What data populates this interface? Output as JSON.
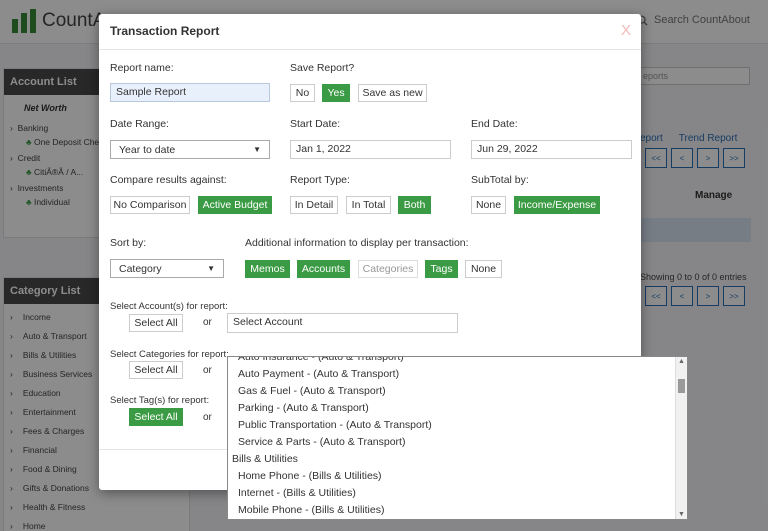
{
  "app": {
    "brand": "CountA",
    "search_label": "Search CountAbout"
  },
  "account_list": {
    "title": "Account List",
    "net_worth": "Net Worth",
    "groups": [
      {
        "label": "Banking",
        "sub": "One Deposit Che..."
      },
      {
        "label": "Credit",
        "sub": "CitiÃ®Ã / A..."
      },
      {
        "label": "Investments",
        "sub": "Individual"
      }
    ]
  },
  "category_list": {
    "title": "Category List",
    "items": [
      "Income",
      "Auto & Transport",
      "Bills & Utilities",
      "Business Services",
      "Education",
      "Entertainment",
      "Fees & Charges",
      "Financial",
      "Food & Dining",
      "Gifts & Donations",
      "Health & Fitness",
      "Home"
    ]
  },
  "background": {
    "filter_placeholder": "eports",
    "link_report": "eport",
    "link_trend": "Trend Report",
    "pager": [
      "<<",
      "<",
      ">",
      ">>"
    ],
    "manage_header": "Manage",
    "showing_text": "Showing 0 to 0 of 0 entries"
  },
  "modal": {
    "title": "Transaction Report",
    "close_glyph": "X",
    "report_name_label": "Report name:",
    "report_name_value": "Sample Report",
    "save_report_label": "Save Report?",
    "save_options": [
      "No",
      "Yes",
      "Save as new"
    ],
    "date_range_label": "Date Range:",
    "date_range_value": "Year to date",
    "start_date_label": "Start Date:",
    "start_date_value": "Jan 1, 2022",
    "end_date_label": "End Date:",
    "end_date_value": "Jun 29, 2022",
    "compare_label": "Compare results against:",
    "compare_options": [
      "No Comparison",
      "Active Budget"
    ],
    "report_type_label": "Report Type:",
    "report_type_options": [
      "In Detail",
      "In Total",
      "Both"
    ],
    "subtotal_label": "SubTotal by:",
    "subtotal_options": [
      "None",
      "Income/Expense"
    ],
    "sort_by_label": "Sort by:",
    "sort_by_value": "Category",
    "additional_label": "Additional information to display per transaction:",
    "additional_options": [
      "Memos",
      "Accounts",
      "Categories",
      "Tags",
      "None"
    ],
    "select_accounts_label": "Select Account(s) for report:",
    "select_all_label": "Select All",
    "or_label": "or",
    "select_account_value": "Select Account",
    "select_categories_label": "Select Categories for report:",
    "select_tags_label": "Select Tag(s) for report:"
  },
  "category_dropdown": {
    "items": [
      {
        "label": "Auto Insurance - (Auto & Transport)",
        "group": false
      },
      {
        "label": "Auto Payment - (Auto & Transport)",
        "group": false
      },
      {
        "label": "Gas & Fuel - (Auto & Transport)",
        "group": false
      },
      {
        "label": "Parking - (Auto & Transport)",
        "group": false
      },
      {
        "label": "Public Transportation - (Auto & Transport)",
        "group": false
      },
      {
        "label": "Service & Parts - (Auto & Transport)",
        "group": false
      },
      {
        "label": "Bills & Utilities",
        "group": true
      },
      {
        "label": "Home Phone - (Bills & Utilities)",
        "group": false
      },
      {
        "label": "Internet - (Bills & Utilities)",
        "group": false
      },
      {
        "label": "Mobile Phone - (Bills & Utilities)",
        "group": false
      }
    ]
  },
  "colors": {
    "accent_green": "#3b9b44",
    "link_blue": "#2a6db5",
    "header_dark": "#4a4a4a"
  }
}
